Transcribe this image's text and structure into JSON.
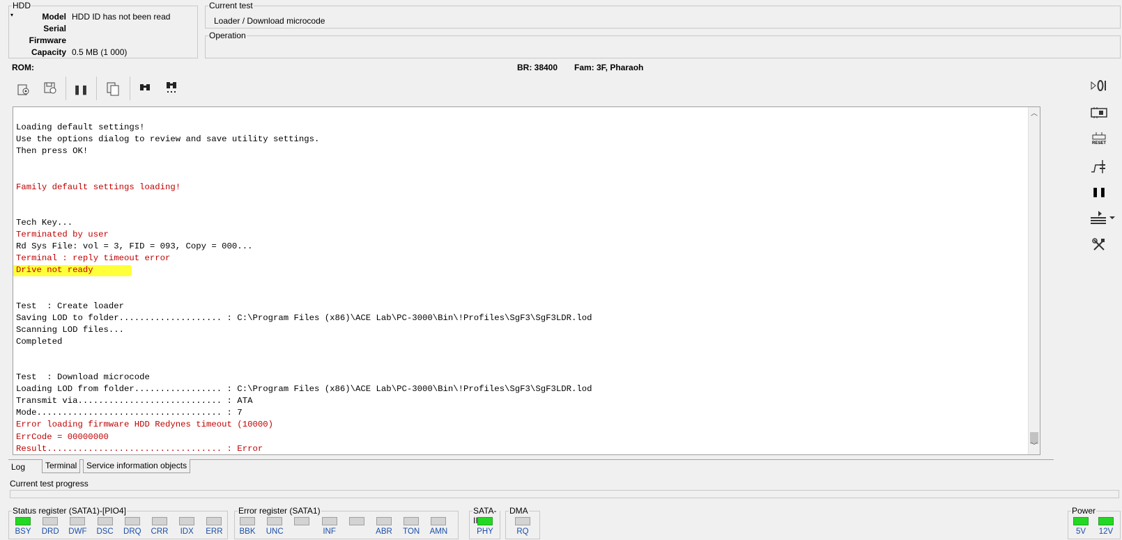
{
  "hdd": {
    "legend": "HDD",
    "model_label": "Model",
    "model_value": "HDD ID has not been read",
    "serial_label": "Serial",
    "serial_value": "",
    "firmware_label": "Firmware",
    "firmware_value": "",
    "capacity_label": "Capacity",
    "capacity_value": "0.5 MB (1 000)"
  },
  "current_test": {
    "legend": "Current test",
    "value": "Loader / Download microcode"
  },
  "operation": {
    "legend": "Operation",
    "value": ""
  },
  "status_line": {
    "rom": "ROM:",
    "br": "BR: 38400",
    "fam": "Fam: 3F, Pharaoh"
  },
  "toolbar": {
    "icons": [
      "load-settings-icon",
      "save-settings-icon",
      "pause-icon",
      "copy-icon",
      "find-icon",
      "find-next-icon"
    ]
  },
  "log_lines": [
    {
      "text": "",
      "red": false
    },
    {
      "text": "Loading default settings!",
      "red": false
    },
    {
      "text": "Use the options dialog to review and save utility settings.",
      "red": false
    },
    {
      "text": "Then press OK!",
      "red": false
    },
    {
      "text": "",
      "red": false
    },
    {
      "text": "",
      "red": false
    },
    {
      "text": "Family default settings loading!",
      "red": true
    },
    {
      "text": "",
      "red": false
    },
    {
      "text": "",
      "red": false
    },
    {
      "text": "Tech Key...",
      "red": false
    },
    {
      "text": "Terminated by user",
      "red": true
    },
    {
      "text": "Rd Sys File: vol = 3, FID = 093, Copy = 000...",
      "red": false
    },
    {
      "text": "Terminal : reply timeout error",
      "red": true
    },
    {
      "text": "Drive not ready",
      "red": true
    },
    {
      "text": "",
      "red": false
    },
    {
      "text": "",
      "red": false
    },
    {
      "text": "Test  : Create loader",
      "red": false
    },
    {
      "text": "Saving LOD to folder.................... : C:\\Program Files (x86)\\ACE Lab\\PC-3000\\Bin\\!Profiles\\SgF3\\SgF3LDR.lod",
      "red": false
    },
    {
      "text": "Scanning LOD files...",
      "red": false
    },
    {
      "text": "Completed",
      "red": false
    },
    {
      "text": "",
      "red": false
    },
    {
      "text": "",
      "red": false
    },
    {
      "text": "Test  : Download microcode",
      "red": false
    },
    {
      "text": "Loading LOD from folder................. : C:\\Program Files (x86)\\ACE Lab\\PC-3000\\Bin\\!Profiles\\SgF3\\SgF3LDR.lod",
      "red": false
    },
    {
      "text": "Transmit via............................ : ATA",
      "red": false
    },
    {
      "text": "Mode.................................... : 7",
      "red": false
    },
    {
      "text": "Error loading firmware HDD Redynes timeout (10000)",
      "red": true
    },
    {
      "text": "ErrCode = 00000000",
      "red": true
    },
    {
      "text": "Result.................................. : Error",
      "red": true
    }
  ],
  "tabs": [
    "Log",
    "Terminal",
    "Service information objects"
  ],
  "progress": {
    "label": "Current test progress",
    "value": 0
  },
  "status_register": {
    "legend": "Status register (SATA1)-[PIO4]",
    "leds": [
      {
        "label": "BSY",
        "on": true
      },
      {
        "label": "DRD",
        "on": false
      },
      {
        "label": "DWF",
        "on": false
      },
      {
        "label": "DSC",
        "on": false
      },
      {
        "label": "DRQ",
        "on": false
      },
      {
        "label": "CRR",
        "on": false
      },
      {
        "label": "IDX",
        "on": false
      },
      {
        "label": "ERR",
        "on": false
      }
    ]
  },
  "error_register": {
    "legend": "Error register (SATA1)",
    "leds": [
      {
        "label": "BBK",
        "on": false
      },
      {
        "label": "UNC",
        "on": false
      },
      {
        "label": "",
        "on": false
      },
      {
        "label": "INF",
        "on": false
      },
      {
        "label": "",
        "on": false
      },
      {
        "label": "ABR",
        "on": false
      },
      {
        "label": "TON",
        "on": false
      },
      {
        "label": "AMN",
        "on": false
      }
    ]
  },
  "sata": {
    "legend": "SATA-II",
    "leds": [
      {
        "label": "PHY",
        "on": true
      }
    ]
  },
  "dma": {
    "legend": "DMA",
    "leds": [
      {
        "label": "RQ",
        "on": false
      }
    ]
  },
  "power": {
    "legend": "Power",
    "leds": [
      {
        "label": "5V",
        "on": true
      },
      {
        "label": "12V",
        "on": true
      }
    ]
  },
  "side_toolbar": {
    "icons": [
      "power-toggle-icon",
      "board-icon",
      "reset-icon",
      "jumper-icon",
      "pause-icon",
      "settings-tools-icon"
    ],
    "reset_label": "RESET"
  },
  "colors": {
    "led_on": "#22d822",
    "led_off": "#d3d3d3",
    "error_text": "#c00000",
    "highlight": "#ffff3a"
  }
}
